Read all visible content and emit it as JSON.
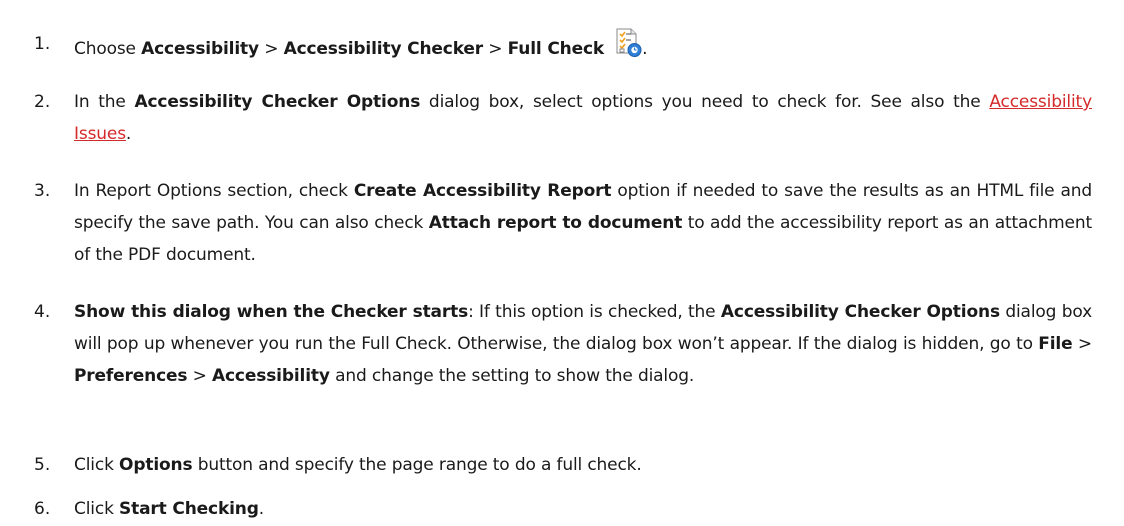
{
  "steps": [
    {
      "number": "1.",
      "parts": [
        "Choose ",
        "Accessibility",
        " > ",
        "Accessibility Checker",
        " > ",
        "Full Check",
        "."
      ],
      "icon": "accessibility-full-check-icon"
    },
    {
      "number": "2.",
      "parts": [
        "In the ",
        "Accessibility Checker Options",
        " dialog box, select options you need to check for. See also the ",
        "Accessibility Issues",
        "."
      ]
    },
    {
      "number": "3.",
      "parts": [
        "In Report Options section, check ",
        "Create Accessibility Report",
        " option if needed to save the results as an HTML file and specify the save path. You can also check ",
        "Attach report to document",
        " to add the accessibility report as an attachment of the PDF document."
      ]
    },
    {
      "number": "4.",
      "parts": [
        "Show this dialog when the Checker starts",
        ": If this option is checked, the ",
        "Accessibility Checker Options",
        " dialog box will pop up whenever you run the Full Check. Otherwise, the dialog box won’t appear. If the dialog is hidden, go to ",
        "File",
        " > ",
        "Preferences",
        " > ",
        "Accessibility",
        " and change the setting to show the dialog."
      ]
    },
    {
      "number": "5.",
      "parts": [
        "Click ",
        "Options",
        " button and specify the page range to do a full check."
      ]
    },
    {
      "number": "6.",
      "parts": [
        "Click ",
        "Start Checking",
        "."
      ]
    }
  ],
  "colors": {
    "link": "#d42a2a",
    "text": "#1a1a1a"
  }
}
